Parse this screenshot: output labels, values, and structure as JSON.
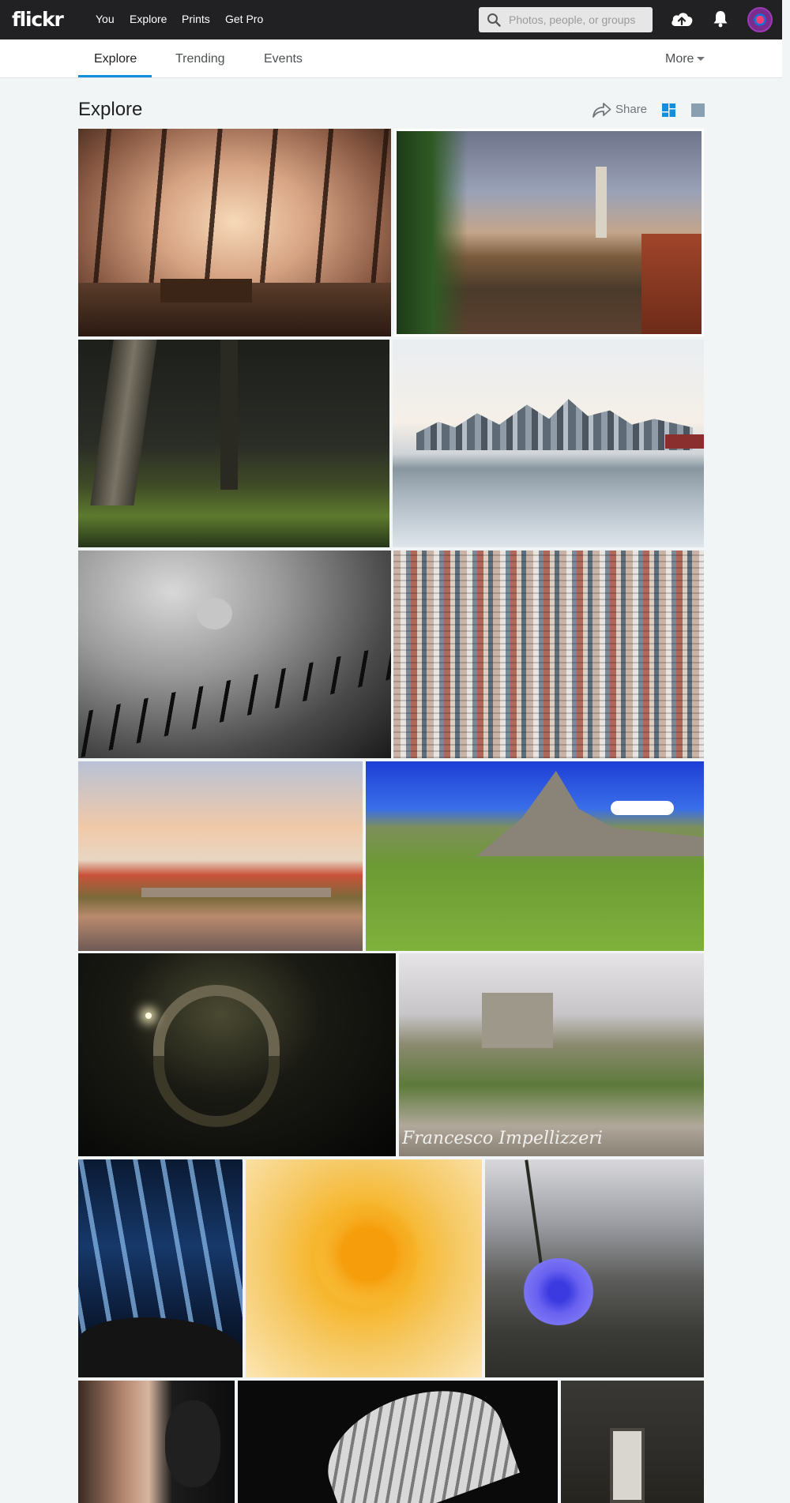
{
  "header": {
    "logo": "flickr",
    "nav": [
      "You",
      "Explore",
      "Prints",
      "Get Pro"
    ],
    "search_placeholder": "Photos, people, or groups",
    "icons": [
      "upload-cloud-icon",
      "notification-bell-icon"
    ]
  },
  "subnav": {
    "tabs": [
      "Explore",
      "Trending",
      "Events"
    ],
    "active_tab": "Explore",
    "more_label": "More"
  },
  "page": {
    "title": "Explore",
    "share_label": "Share",
    "view_modes": [
      "justified-view-icon",
      "single-view-icon"
    ],
    "active_view": "justified-view-icon"
  },
  "photos": [
    {
      "subject": "misty sunlit forest with wooden picnic table"
    },
    {
      "subject": "Czech riverside town with church tower"
    },
    {
      "subject": "dark forest with tall grass"
    },
    {
      "subject": "city skyline reflected in harbor with boats"
    },
    {
      "subject": "black and white squirrel on iron fence"
    },
    {
      "subject": "dense high-rise apartment buildings"
    },
    {
      "subject": "old town with stone bridge at sunset"
    },
    {
      "subject": "green alpine meadow under rocky peaks"
    },
    {
      "subject": "stone arch bridge reflected at night"
    },
    {
      "subject": "medieval castle on cliff",
      "watermark": "Francesco Impellizzeri"
    },
    {
      "subject": "long exposure blue waterfall"
    },
    {
      "subject": "orange maple leaves"
    },
    {
      "subject": "blue chicory flower"
    },
    {
      "subject": "woman with black mask"
    },
    {
      "subject": "black and white spiral shell"
    },
    {
      "subject": "window in dark stone wall"
    }
  ],
  "colors": {
    "topbar": "#212124",
    "accent": "#128fdc",
    "background": "#f2f5f6"
  }
}
